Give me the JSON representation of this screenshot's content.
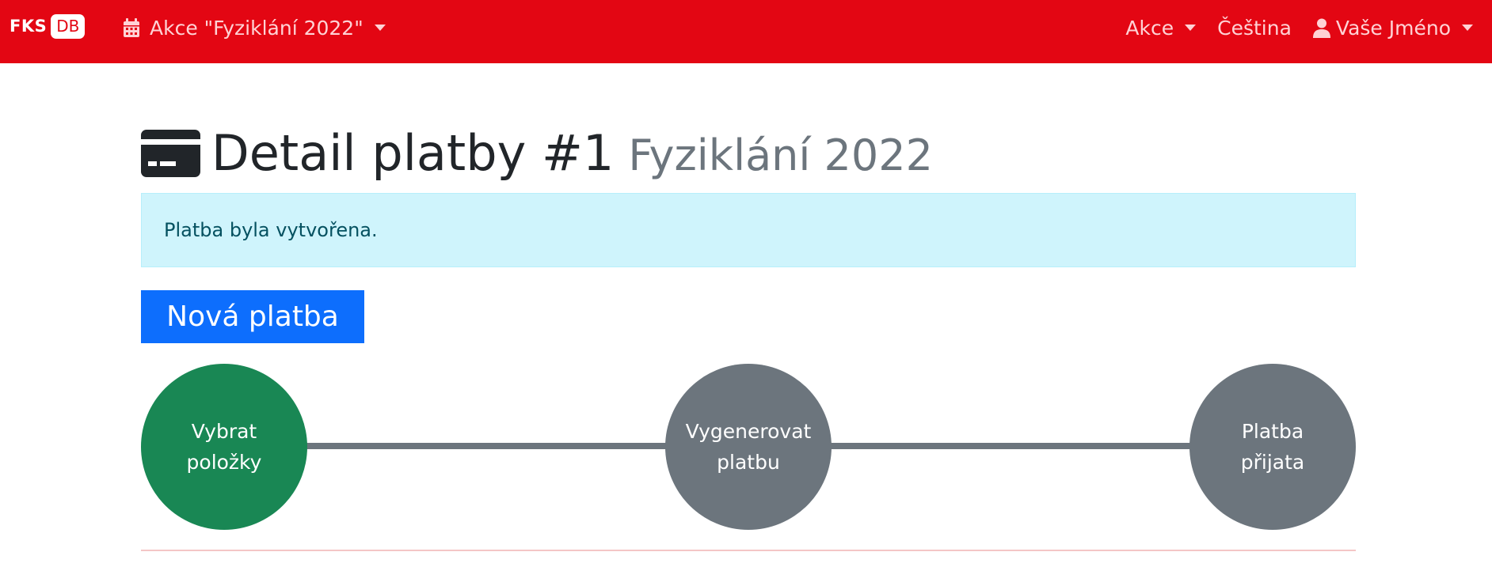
{
  "navbar": {
    "brand_left": "FKS",
    "brand_right": "DB",
    "event_icon": "calendar-icon",
    "event_label": "Akce \"Fyziklání 2022\"",
    "right_items": {
      "events": "Akce",
      "language": "Čeština",
      "user": "Vaše Jméno",
      "user_icon": "user-icon"
    },
    "colors": {
      "background": "#e30613",
      "text": "#ffd2d5"
    }
  },
  "page": {
    "icon": "credit-card-icon",
    "title": "Detail platby #1",
    "subtitle": "Fyziklání 2022"
  },
  "alert": {
    "message": "Platba byla vytvořena.",
    "color": "#cff4fc"
  },
  "actions": {
    "new_payment_label": "Nová platba",
    "color": "#0d6efd"
  },
  "steps": [
    {
      "line1": "Vybrat",
      "line2": "položky",
      "state": "active",
      "color": "#198754"
    },
    {
      "line1": "Vygenerovat",
      "line2": "platbu",
      "state": "pending",
      "color": "#6c757d"
    },
    {
      "line1": "Platba",
      "line2": "přijata",
      "state": "pending",
      "color": "#6c757d"
    }
  ]
}
